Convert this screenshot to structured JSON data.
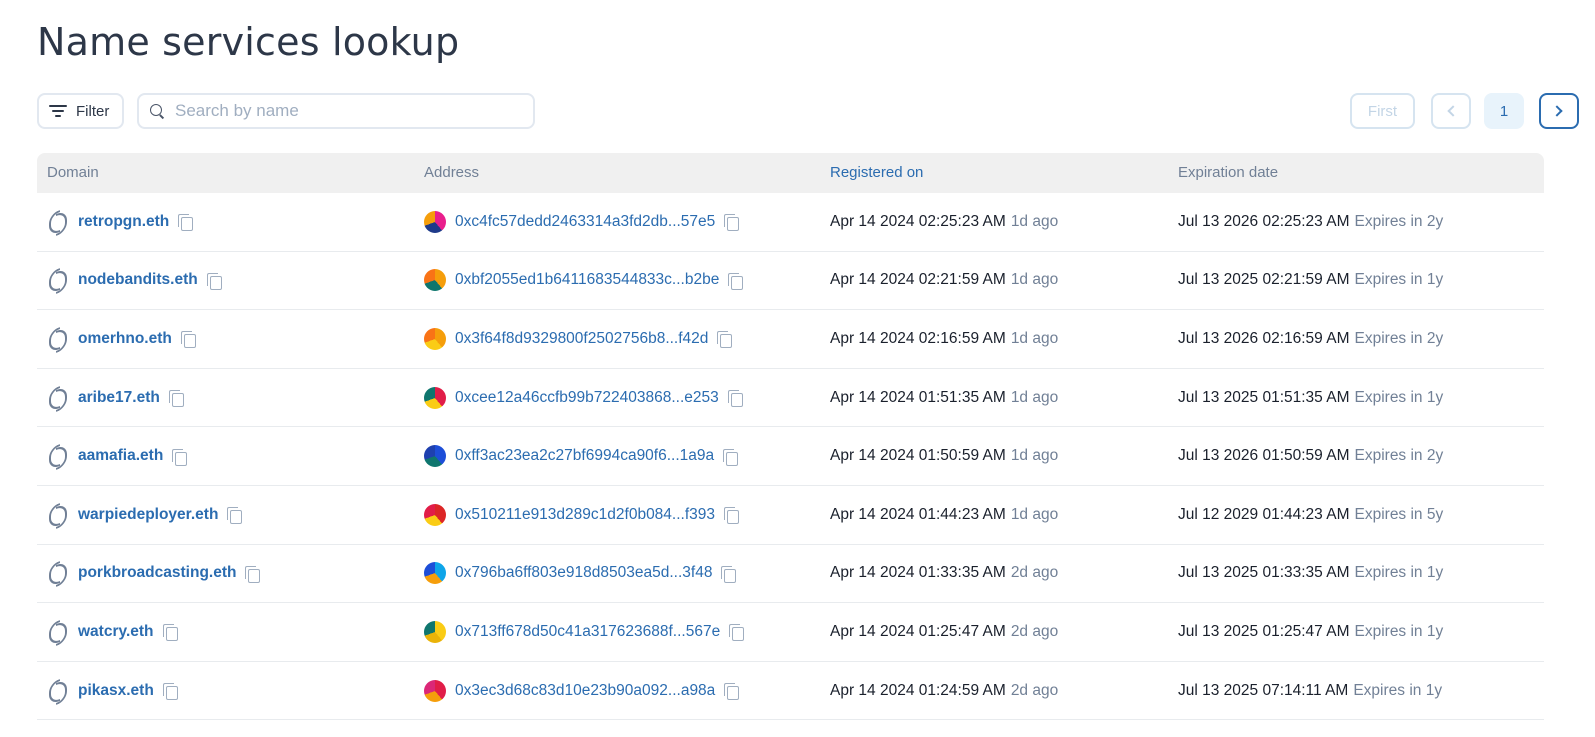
{
  "page": {
    "title": "Name services lookup"
  },
  "toolbar": {
    "filter_label": "Filter",
    "search_placeholder": "Search by name"
  },
  "pagination": {
    "first_label": "First",
    "current_page": "1"
  },
  "table": {
    "headers": {
      "domain": "Domain",
      "address": "Address",
      "registered": "Registered on",
      "expiration": "Expiration date"
    },
    "rows": [
      {
        "domain": "retropgn.eth",
        "address": "0xc4fc57dedd2463314a3fd2db...57e5",
        "registered": "Apr 14 2024 02:25:23 AM",
        "registered_ago": "1d ago",
        "expiration": "Jul 13 2026 02:25:23 AM",
        "expires_in": "Expires in 2y",
        "avatar_colors": [
          "#e91e8c",
          "#1e3a8a",
          "#f59e0b"
        ]
      },
      {
        "domain": "nodebandits.eth",
        "address": "0xbf2055ed1b6411683544833c...b2be",
        "registered": "Apr 14 2024 02:21:59 AM",
        "registered_ago": "1d ago",
        "expiration": "Jul 13 2025 02:21:59 AM",
        "expires_in": "Expires in 1y",
        "avatar_colors": [
          "#f59e0b",
          "#0f766e",
          "#f97316"
        ]
      },
      {
        "domain": "omerhno.eth",
        "address": "0x3f64f8d9329800f2502756b8...f42d",
        "registered": "Apr 14 2024 02:16:59 AM",
        "registered_ago": "1d ago",
        "expiration": "Jul 13 2026 02:16:59 AM",
        "expires_in": "Expires in 2y",
        "avatar_colors": [
          "#f59e0b",
          "#facc15",
          "#f97316"
        ]
      },
      {
        "domain": "aribe17.eth",
        "address": "0xcee12a46ccfb99b722403868...e253",
        "registered": "Apr 14 2024 01:51:35 AM",
        "registered_ago": "1d ago",
        "expiration": "Jul 13 2025 01:51:35 AM",
        "expires_in": "Expires in 1y",
        "avatar_colors": [
          "#e11d48",
          "#facc15",
          "#0f766e"
        ]
      },
      {
        "domain": "aamafia.eth",
        "address": "0xff3ac23ea2c27bf6994ca90f6...1a9a",
        "registered": "Apr 14 2024 01:50:59 AM",
        "registered_ago": "1d ago",
        "expiration": "Jul 13 2026 01:50:59 AM",
        "expires_in": "Expires in 2y",
        "avatar_colors": [
          "#1d4ed8",
          "#0f766e",
          "#1e40af"
        ]
      },
      {
        "domain": "warpiedeployer.eth",
        "address": "0x510211e913d289c1d2f0b084...f393",
        "registered": "Apr 14 2024 01:44:23 AM",
        "registered_ago": "1d ago",
        "expiration": "Jul 12 2029 01:44:23 AM",
        "expires_in": "Expires in 5y",
        "avatar_colors": [
          "#dc2626",
          "#facc15",
          "#e11d48"
        ]
      },
      {
        "domain": "porkbroadcasting.eth",
        "address": "0x796ba6ff803e918d8503ea5d...3f48",
        "registered": "Apr 14 2024 01:33:35 AM",
        "registered_ago": "2d ago",
        "expiration": "Jul 13 2025 01:33:35 AM",
        "expires_in": "Expires in 1y",
        "avatar_colors": [
          "#0ea5e9",
          "#f59e0b",
          "#1d4ed8"
        ]
      },
      {
        "domain": "watcry.eth",
        "address": "0x713ff678d50c41a317623688f...567e",
        "registered": "Apr 14 2024 01:25:47 AM",
        "registered_ago": "2d ago",
        "expiration": "Jul 13 2025 01:25:47 AM",
        "expires_in": "Expires in 1y",
        "avatar_colors": [
          "#facc15",
          "#eab308",
          "#0f766e"
        ]
      },
      {
        "domain": "pikasx.eth",
        "address": "0x3ec3d68c83d10e23b90a092...a98a",
        "registered": "Apr 14 2024 01:24:59 AM",
        "registered_ago": "2d ago",
        "expiration": "Jul 13 2025 07:14:11 AM",
        "expires_in": "Expires in 1y",
        "avatar_colors": [
          "#e11d48",
          "#f59e0b",
          "#db2777"
        ]
      }
    ]
  }
}
